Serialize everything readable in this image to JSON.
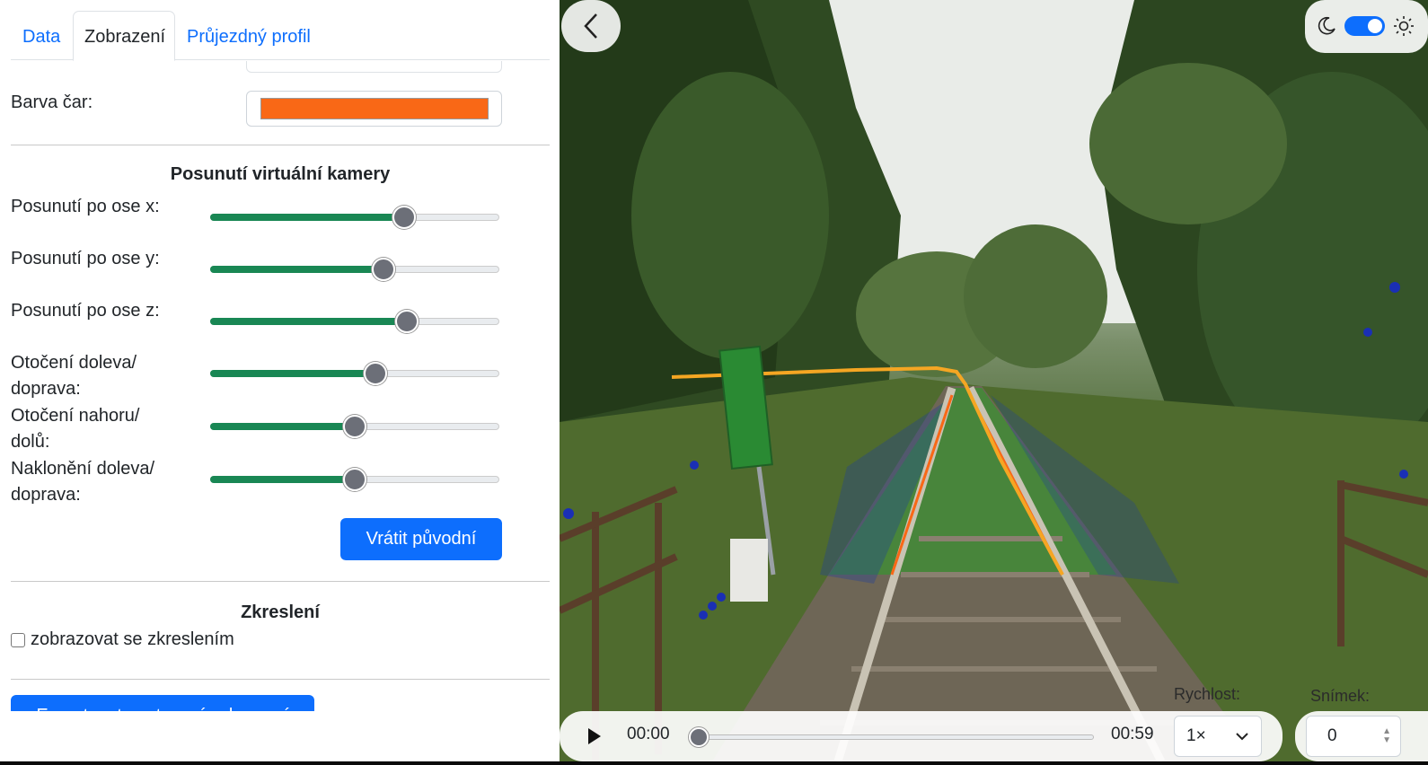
{
  "tabs": [
    {
      "label": "Data"
    },
    {
      "label": "Zobrazení"
    },
    {
      "label": "Průjezdný profil"
    }
  ],
  "display": {
    "line_color_label": "Barva čar:",
    "line_color": "#f96816"
  },
  "camera": {
    "section_title": "Posunutí virtuální kamery",
    "sliders": [
      {
        "label": "Posunutí po ose x:",
        "value": 0.67
      },
      {
        "label": "Posunutí po ose y:",
        "value": 0.6
      },
      {
        "label": "Posunutí po ose z:",
        "value": 0.68
      },
      {
        "label": "Otočení doleva/ doprava:",
        "value": 0.57
      },
      {
        "label": "Otočení nahoru/ dolů:",
        "value": 0.5
      },
      {
        "label": "Naklonění doleva/ doprava:",
        "value": 0.5
      }
    ],
    "reset_label": "Vrátit původní"
  },
  "distortion": {
    "section_title": "Zkreslení",
    "checkbox_label": "zobrazovat se zkreslením"
  },
  "export_label": "Exportovat nastavení zobrazení",
  "player": {
    "time_current": "00:00",
    "time_total": "00:59",
    "speed_label": "Rychlost:",
    "speed_value": "1×",
    "frame_label": "Snímek:",
    "frame_value": "0",
    "progress": 0
  },
  "colors": {
    "primary": "#0d6efd",
    "slider_fill": "#198754",
    "route_line": "#f5a623"
  }
}
